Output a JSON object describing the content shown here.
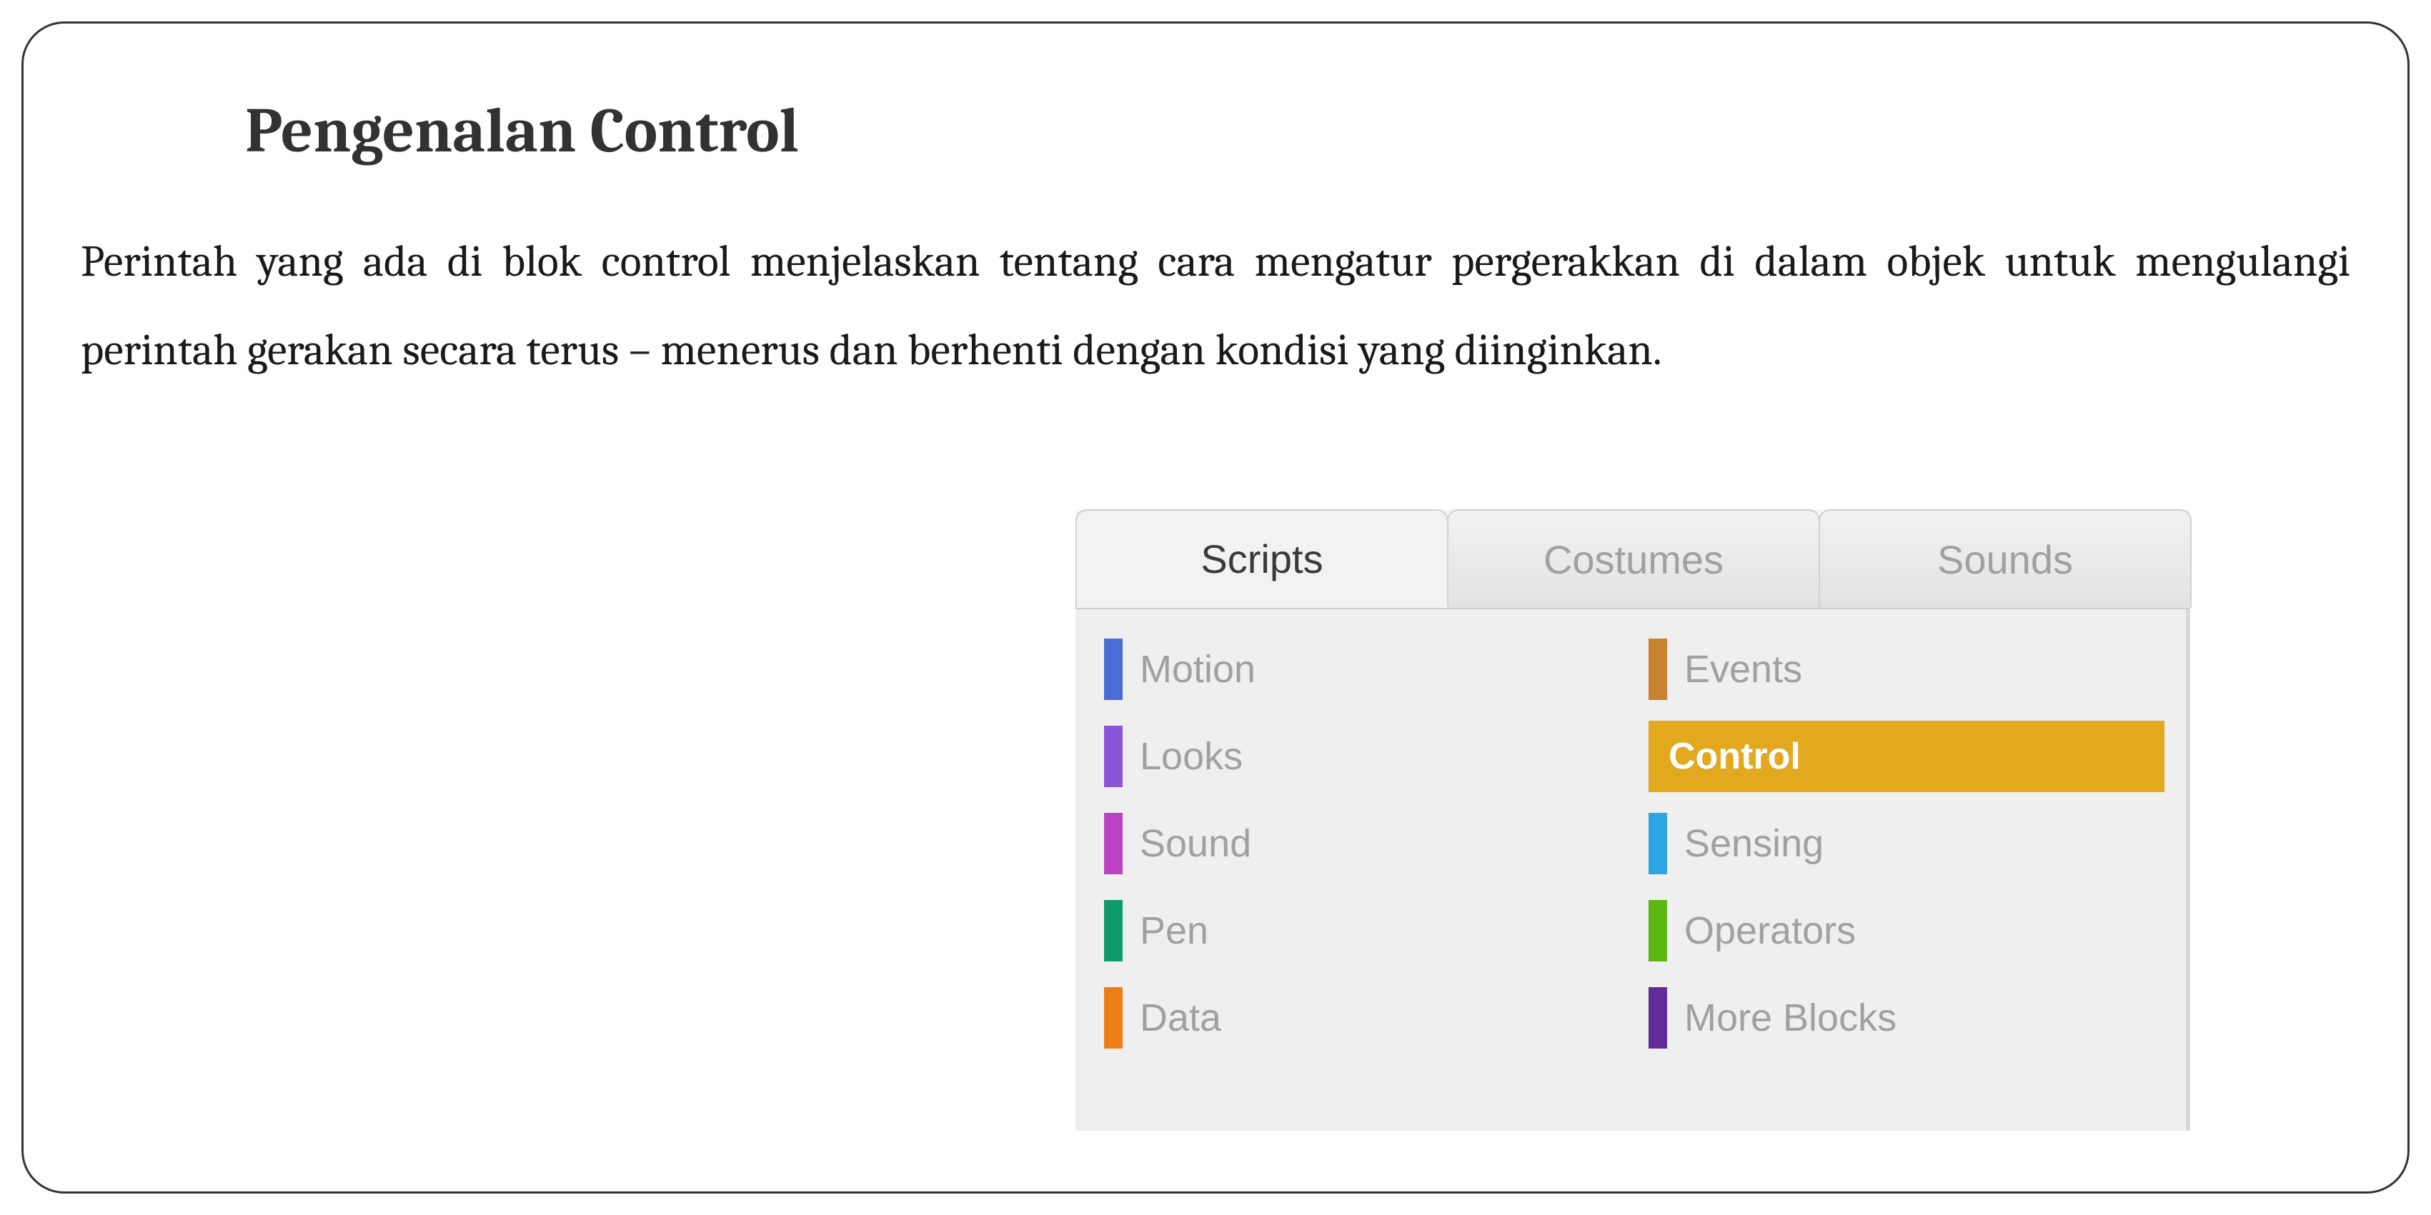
{
  "heading": "Pengenalan Control",
  "body": "Perintah yang ada di blok control menjelaskan tentang cara mengatur pergerakkan di dalam objek untuk mengulangi perintah gerakan secara  terus – menerus dan berhenti dengan kondisi yang diinginkan.",
  "screenshot": {
    "tabs": [
      {
        "label": "Scripts",
        "active": true
      },
      {
        "label": "Costumes",
        "active": false
      },
      {
        "label": "Sounds",
        "active": false
      }
    ],
    "categories_left": [
      {
        "label": "Motion",
        "color": "#4a6cd4",
        "selected": false
      },
      {
        "label": "Looks",
        "color": "#8a55d7",
        "selected": false
      },
      {
        "label": "Sound",
        "color": "#bb42c3",
        "selected": false
      },
      {
        "label": "Pen",
        "color": "#0e9a6c",
        "selected": false
      },
      {
        "label": "Data",
        "color": "#ee7d16",
        "selected": false
      }
    ],
    "categories_right": [
      {
        "label": "Events",
        "color": "#c88330",
        "selected": false
      },
      {
        "label": "Control",
        "color": "#e2a91f",
        "selected": true
      },
      {
        "label": "Sensing",
        "color": "#2ca5e2",
        "selected": false
      },
      {
        "label": "Operators",
        "color": "#5cb712",
        "selected": false
      },
      {
        "label": "More Blocks",
        "color": "#632d99",
        "selected": false
      }
    ]
  }
}
